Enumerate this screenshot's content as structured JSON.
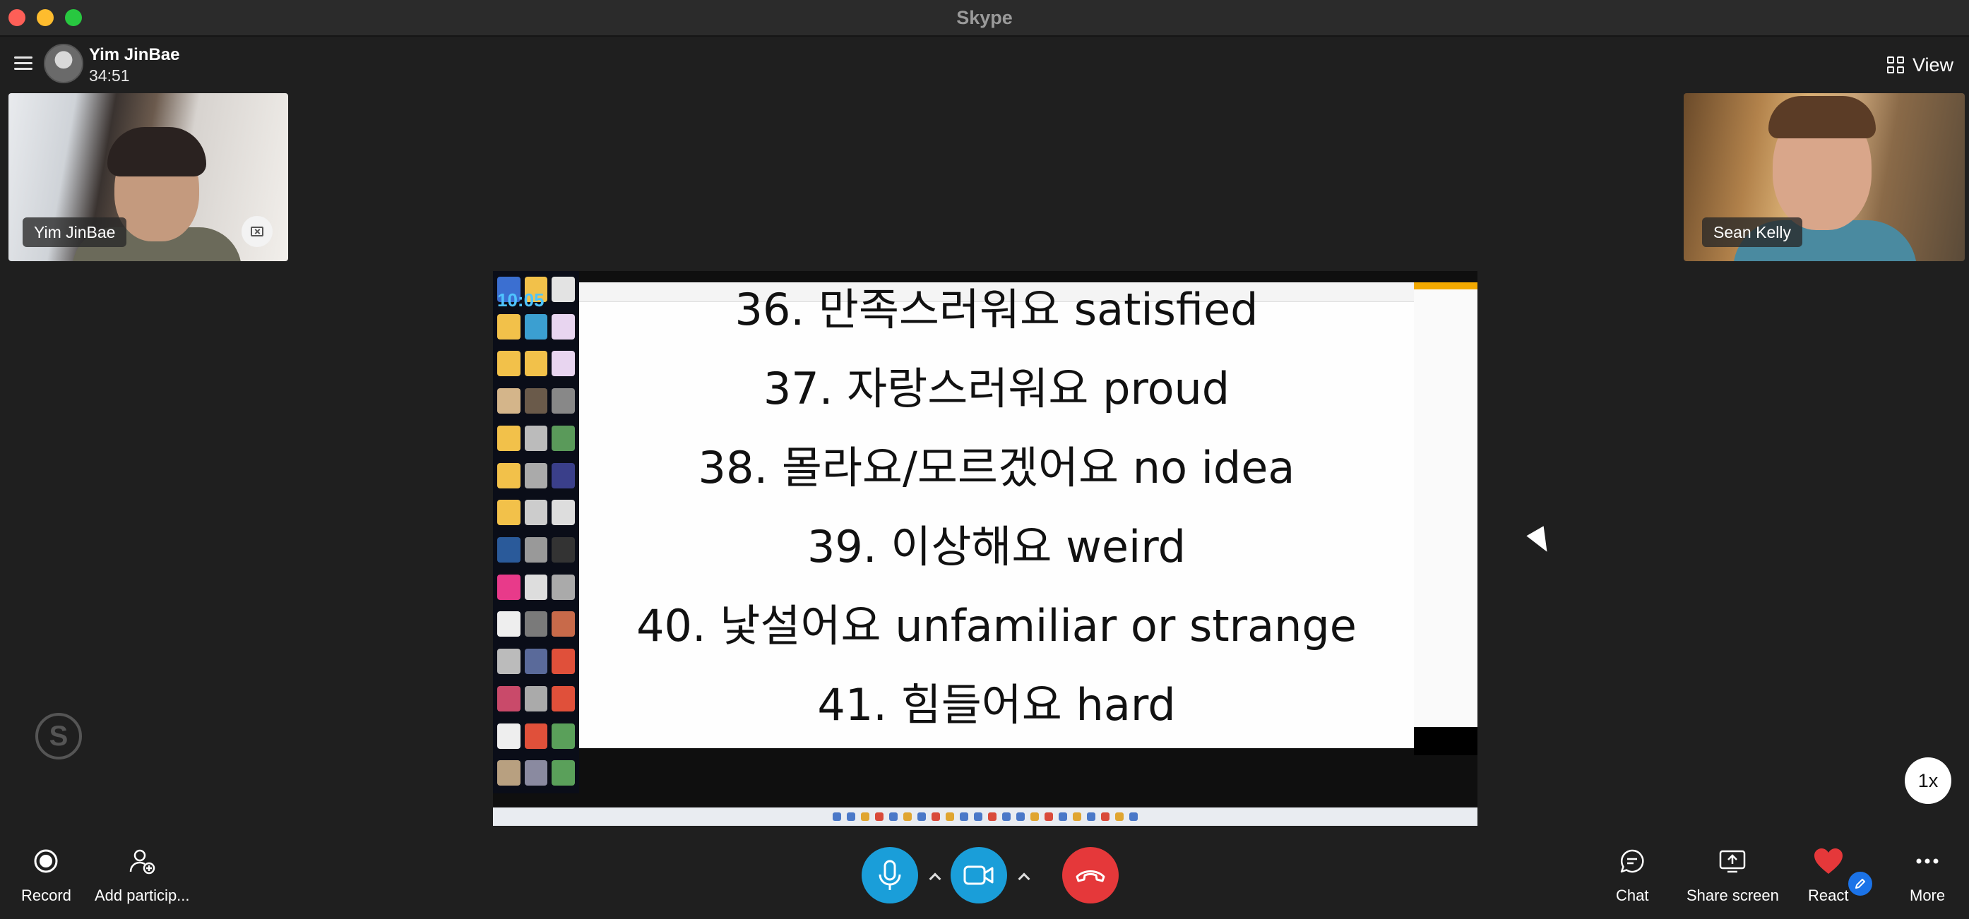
{
  "app": {
    "title": "Skype"
  },
  "header": {
    "caller_name": "Yim JinBae",
    "call_timer": "34:51",
    "view_label": "View"
  },
  "participants": [
    {
      "name": "Yim JinBae"
    },
    {
      "name": "Sean Kelly"
    }
  ],
  "shared_screen": {
    "desktop_clock": "10:05",
    "lines": [
      "36. 만족스러워요 satisfied",
      "37. 자랑스러워요 proud",
      "38. 몰라요/모르겠어요 no idea",
      "39. 이상해요 weird",
      "40. 낯설어요 unfamiliar or strange",
      "41. 힘들어요 hard"
    ]
  },
  "playback_speed": "1x",
  "toolbar": {
    "record_label": "Record",
    "add_participant_label": "Add particip...",
    "chat_label": "Chat",
    "share_screen_label": "Share screen",
    "react_label": "React",
    "more_label": "More"
  },
  "colors": {
    "call_blue": "#1a9ed9",
    "hangup_red": "#e5383a",
    "react_heart": "#e5383a"
  }
}
